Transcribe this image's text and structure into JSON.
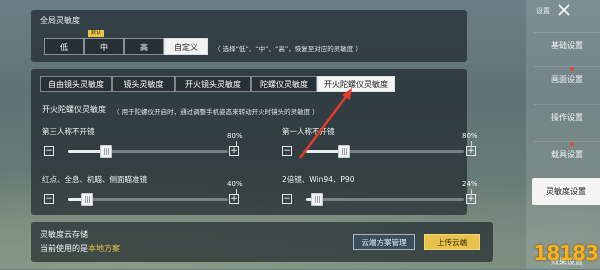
{
  "global": {
    "title": "全局灵敏度",
    "options": [
      "低",
      "中",
      "高",
      "自定义"
    ],
    "default_badge": "默认",
    "hint": "（ 选择“低”、“中”、“高”，恢复至对应的灵敏度 ）"
  },
  "tabs": [
    "自由镜头灵敏度",
    "镜头灵敏度",
    "开火镜头灵敏度",
    "陀螺仪灵敏度",
    "开火陀螺仪灵敏度"
  ],
  "section": {
    "title": "开火陀螺仪灵敏度",
    "desc": "（ 用于陀螺仪开启时，通过调整手机姿态来转动开火时镜头的灵敏度 ）"
  },
  "sliders": [
    {
      "label": "第三人称不开镜",
      "value_text": "80%",
      "value": 0.8,
      "knob": 0.24
    },
    {
      "label": "第一人称不开镜",
      "value_text": "80%",
      "value": 0.8,
      "knob": 0.24
    },
    {
      "label": "红点、全息、机瞄、侧面瞄准镜",
      "value_text": "40%",
      "value": 0.4,
      "knob": 0.12
    },
    {
      "label": "2倍镜、Win94、P90",
      "value_text": "24%",
      "value": 0.24,
      "knob": 0.07
    }
  ],
  "cloud": {
    "title": "灵敏度云存储",
    "current_prefix": "当前使用的是",
    "current_plan": "本地方案",
    "manage_btn": "云端方案管理",
    "upload_btn": "上传云端"
  },
  "sidebar": {
    "header": "设置",
    "items": [
      "基础设置",
      "画面设置",
      "操作设置",
      "载具设置",
      "灵敏度设置",
      "效果设置"
    ]
  },
  "watermark": "18183",
  "colors": {
    "accent_gold": "#e8c24a",
    "arrow_red": "#e23a2e",
    "active_tab": "#f4f4f4"
  }
}
